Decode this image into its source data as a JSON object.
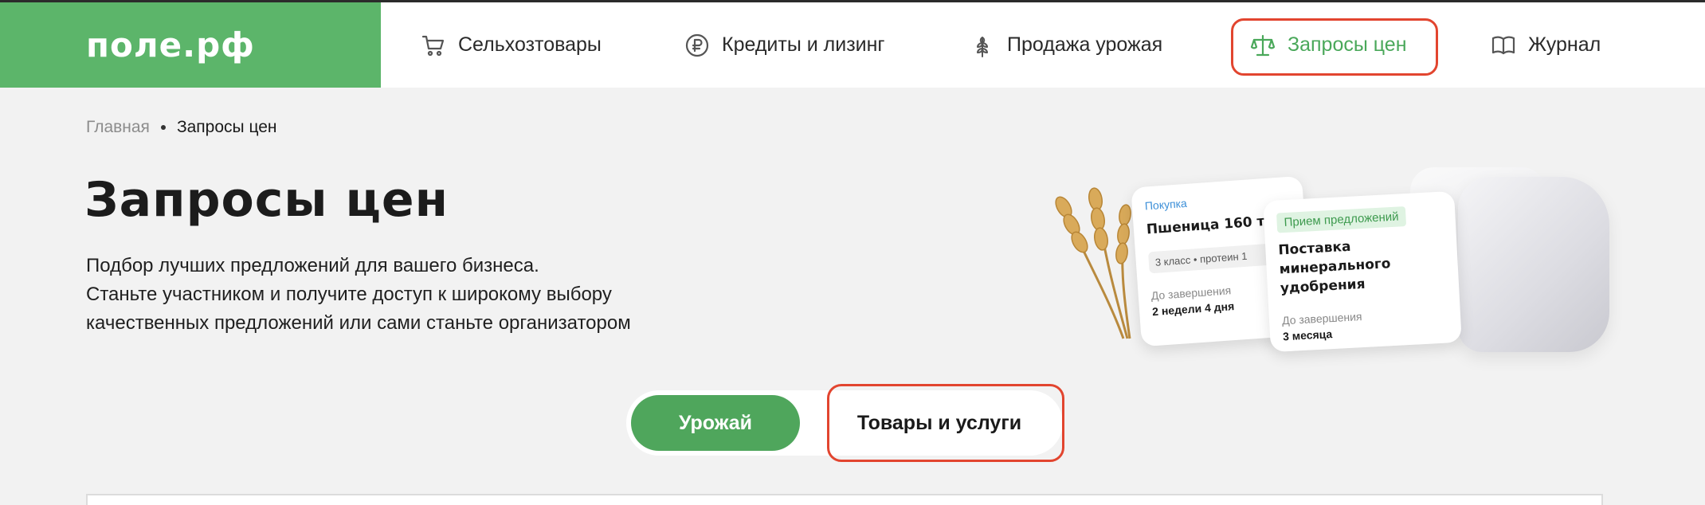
{
  "header": {
    "logo": "поле.рф",
    "nav": [
      {
        "label": "Сельхозтовары",
        "icon": "cart-icon"
      },
      {
        "label": "Кредиты и лизинг",
        "icon": "ruble-icon"
      },
      {
        "label": "Продажа урожая",
        "icon": "wheat-icon"
      },
      {
        "label": "Запросы цен",
        "icon": "scales-icon",
        "active": true
      },
      {
        "label": "Журнал",
        "icon": "book-icon"
      }
    ]
  },
  "breadcrumb": {
    "home": "Главная",
    "current": "Запросы цен"
  },
  "page": {
    "title": "Запросы цен",
    "description": [
      "Подбор лучших предложений для вашего бизнеса.",
      "Станьте участником и получите доступ к широкому выбору",
      "качественных предложений или сами станьте организатором"
    ]
  },
  "hero": {
    "card1": {
      "tag": "Покупка",
      "title": "Пшеница 160 т",
      "chips": "3 класс • протеин 1",
      "deadline_label": "До завершения",
      "deadline_value": "2 недели 4 дня"
    },
    "card2": {
      "tag": "Прием предложений",
      "title": "Поставка минерального удобрения",
      "deadline_label": "До завершения",
      "deadline_value": "3 месяца"
    }
  },
  "toggle": {
    "harvest": "Урожай",
    "goods": "Товары и услуги"
  },
  "colors": {
    "brand_green": "#5cb56a",
    "active_green": "#4fa65c",
    "highlight_red": "#e2452f"
  }
}
